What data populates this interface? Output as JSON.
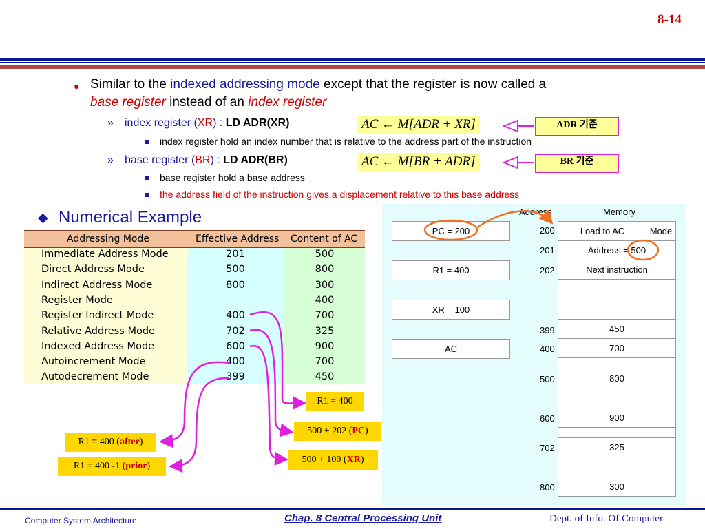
{
  "slide_number": "8-14",
  "bullet": {
    "p1": "Similar to the ",
    "p2": "indexed addressing mode",
    "p3": " except that the register is now called a",
    "p4": "base register",
    "p5": " instead of an ",
    "p6": "index register"
  },
  "index_reg": {
    "label_a": "index register (",
    "label_b": "XR",
    "label_c": ") : ",
    "instr": "LD  ADR(XR)",
    "formula": "AC ← M[ADR + XR]",
    "tag": "ADR 기준",
    "detail": "index register hold an index number that is relative to the address part of the instruction"
  },
  "base_reg": {
    "label_a": "base register (",
    "label_b": "BR",
    "label_c": ") : ",
    "instr": "LD  ADR(BR)",
    "formula": "AC ← M[BR + ADR]",
    "tag": "BR 기준",
    "detail1": "base register hold a base address",
    "detail2": "the address field of the instruction gives a displacement relative to this base address"
  },
  "section_title": "Numerical Example",
  "table": {
    "headers": [
      "Addressing Mode",
      "Effective Address",
      "Content of AC"
    ],
    "rows": [
      [
        "Immediate Address Mode",
        "201",
        "500"
      ],
      [
        "Direct Address Mode",
        "500",
        "800"
      ],
      [
        "Indirect Address Mode",
        "800",
        "300"
      ],
      [
        "Register Mode",
        "",
        "400"
      ],
      [
        "Register Indirect Mode",
        "400",
        "700"
      ],
      [
        "Relative Address Mode",
        "702",
        "325"
      ],
      [
        "Indexed Address Mode",
        "600",
        "900"
      ],
      [
        "Autoincrement Mode",
        "400",
        "700"
      ],
      [
        "Autodecrement Mode",
        "399",
        "450"
      ]
    ]
  },
  "memory_panel": {
    "address_header": "Address",
    "memory_header": "Memory",
    "registers": [
      "PC = 200",
      "R1 = 400",
      "XR = 100",
      "AC"
    ],
    "load_to_ac": "Load to AC",
    "mode": "Mode",
    "address_label": "Address = ",
    "address_value": "500",
    "next_instruction": "Next instruction",
    "addresses": [
      "200",
      "201",
      "202",
      "399",
      "400",
      "500",
      "600",
      "702",
      "800"
    ],
    "values": [
      "450",
      "700",
      "800",
      "900",
      "325",
      "300"
    ]
  },
  "notes": {
    "r1": "R1 = 400",
    "pc_a": "500 + 202 (",
    "pc_b": "PC",
    "pc_c": ")",
    "xr_a": "500 + 100 (",
    "xr_b": "XR",
    "xr_c": ")",
    "after_a": "R1 = 400 (",
    "after_b": "after",
    "after_c": ")",
    "prior_a": "R1 = 400 -1 (",
    "prior_b": "prior",
    "prior_c": ")"
  },
  "footer": {
    "left": "Computer System Architecture",
    "center": "Chap. 8  Central Processing Unit",
    "right": "Dept. of Info. Of Computer"
  },
  "colors": {
    "accent_blue": "#1a1aa0",
    "accent_red": "#cc0000",
    "highlight": "#ffff99",
    "note_gold": "#ffd700",
    "arrow_magenta": "#e020e0",
    "circle_orange": "#f07020"
  }
}
